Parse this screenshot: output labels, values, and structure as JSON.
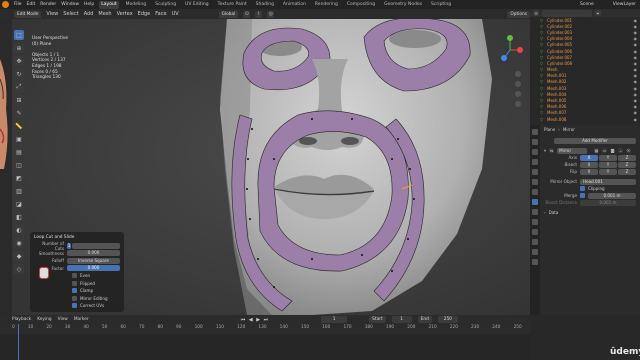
{
  "menu": {
    "items": [
      "File",
      "Edit",
      "Render",
      "Window",
      "Help"
    ],
    "workspaces": [
      "Layout",
      "Modeling",
      "Sculpting",
      "UV Editing",
      "Texture Paint",
      "Shading",
      "Animation",
      "Rendering",
      "Compositing",
      "Geometry Nodes",
      "Scripting"
    ],
    "active_workspace": "Layout",
    "scene": "Scene",
    "view_layer": "ViewLayer"
  },
  "header": {
    "mode": "Edit Mode",
    "menus": [
      "View",
      "Select",
      "Add",
      "Mesh",
      "Vertex",
      "Edge",
      "Face",
      "UV"
    ],
    "transform_orientation": "Global",
    "options": "Options"
  },
  "overlay": {
    "lines": [
      "User Perspective",
      "(0) Plane",
      "",
      "Objects    1 / 1",
      "Vertices   2 / 137",
      "Edges      1 / 198",
      "Faces      0 / 65",
      "Triangles  130"
    ]
  },
  "operator_panel": {
    "title": "Loop Cut and Slide",
    "rows": [
      {
        "label": "Number of Cuts",
        "value": "1",
        "style": "blue-small"
      },
      {
        "label": "Smoothness",
        "value": "0.000",
        "style": "grey"
      },
      {
        "label": "Falloff",
        "value": "Inverse Square",
        "style": "grey"
      },
      {
        "label": "Factor",
        "value": "0.000",
        "style": "blue"
      }
    ],
    "checks": [
      {
        "label": "Even",
        "on": false
      },
      {
        "label": "Flipped",
        "on": false
      },
      {
        "label": "Clamp",
        "on": true
      },
      {
        "label": "Mirror Editing",
        "on": false
      },
      {
        "label": "Correct UVs",
        "on": true
      }
    ]
  },
  "outliner": {
    "items": [
      "Cylinder.001",
      "Cylinder.002",
      "Cylinder.003",
      "Cylinder.004",
      "Cylinder.005",
      "Cylinder.006",
      "Cylinder.007",
      "Cylinder.008",
      "Mesh",
      "Mesh.001",
      "Mesh.002",
      "Mesh.003",
      "Mesh.004",
      "Mesh.005",
      "Mesh.006",
      "Mesh.007",
      "Mesh.008"
    ]
  },
  "properties": {
    "breadcrumb_object": "Plane",
    "breadcrumb_modifier": "Mirror",
    "add_modifier": "Add Modifier",
    "modifier_name": "Mirror",
    "axis_label": "Axis",
    "bisect_label": "Bisect",
    "flip_label": "Flip",
    "axes": [
      "X",
      "Y",
      "Z"
    ],
    "mirror_object_label": "Mirror Object",
    "mirror_object_value": "Head.001",
    "clipping_label": "Clipping",
    "merge_label": "Merge",
    "merge_value": "0.001 m",
    "bisect_distance_label": "Bisect Distance",
    "bisect_distance_value": "0.001 m",
    "data_label": "Data"
  },
  "timeline": {
    "menus": [
      "Playback",
      "Keying",
      "View",
      "Marker"
    ],
    "ruler": [
      "0",
      "10",
      "20",
      "30",
      "40",
      "50",
      "60",
      "70",
      "80",
      "90",
      "100",
      "110",
      "120",
      "130",
      "140",
      "150",
      "160",
      "170",
      "180",
      "190",
      "200",
      "210",
      "220",
      "230",
      "240",
      "250"
    ],
    "current_frame": "1",
    "start_label": "Start",
    "start_value": "1",
    "end_label": "End",
    "end_value": "250"
  },
  "watermark": "ûdemy",
  "colors": {
    "accent": "#4772b3",
    "blender_orange": "#e87d0d",
    "skin": "#b9b9b9",
    "selection_faces": "#9b7fa8"
  }
}
